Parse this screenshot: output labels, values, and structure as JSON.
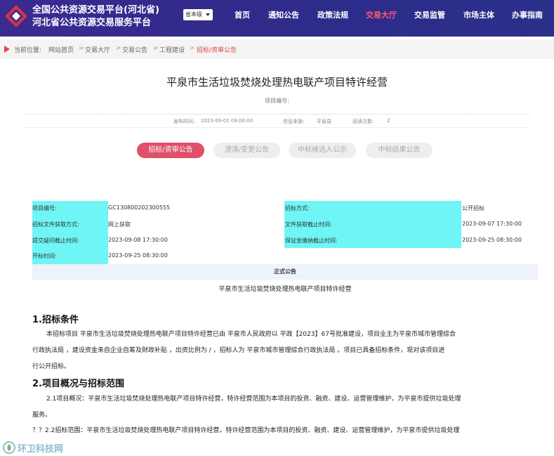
{
  "header": {
    "title_line1": "全国公共资源交易平台(河北省)",
    "title_line2": "河北省公共资源交易服务平台",
    "level_select": "省本级",
    "nav": [
      "首页",
      "通知公告",
      "政策法规",
      "交易大厅",
      "交易监管",
      "市场主体",
      "办事指南"
    ],
    "active_nav": "交易大厅"
  },
  "breadcrumb": {
    "label": "当前位置:",
    "items": [
      "网站首页",
      "交易大厅",
      "交易公告",
      "工程建设",
      "招标/资审公告"
    ],
    "separator": ">"
  },
  "article": {
    "title": "平泉市生活垃圾焚烧处理热电联产项目特许经营",
    "project_no_label": "项目编号:",
    "meta": {
      "publish_label": "发布时间:",
      "publish_time": "2023-09-01 09:00:00",
      "source_label": "信息来源:",
      "source": "平泉县",
      "views_label": "阅读次数:",
      "views": "2"
    }
  },
  "tabs": [
    {
      "label": "招标/资审公告",
      "active": true
    },
    {
      "label": "澄清/变更公告",
      "active": false
    },
    {
      "label": "中标候选人公示",
      "active": false
    },
    {
      "label": "中标结果公告",
      "active": false
    }
  ],
  "info": {
    "r1": {
      "l1": "项目编号:",
      "v1": "GC130800202300555",
      "l2": "招标方式:",
      "v2": "公开招标"
    },
    "r2": {
      "l1": "招标文件获取方式:",
      "v1": "网上获取",
      "l2": "文件获取截止时间:",
      "v2": "2023-09-07 17:30:00"
    },
    "r3": {
      "l1": "提交疑问截止时间:",
      "v1": "2023-09-08 17:30:00",
      "l2": "保证金缴纳截止时间:",
      "v2": "2023-09-25 08:30:00"
    },
    "r4": {
      "l1": "开标时间:",
      "v1": "2023-09-25 08:30:00"
    }
  },
  "notice": {
    "bar": "正式公告",
    "name": "平泉市生活垃圾焚烧处理热电联产项目特许经营"
  },
  "sections": {
    "s1_title": "1.招标条件",
    "s1_line1": "本招标项目  平泉市生活垃圾焚烧处理热电联产项目特许经营已由 平泉市人民政府以 平政【2023】67号批准建设，项目业主为平泉市城市管理综合",
    "s1_line2": "行政执法局 ，建设资金来自企业自筹及财政补贴 ，出资比例为  / ，招标人为  平泉市城市管理综合行政执法局 。项目已具备招标条件，现对该项目进",
    "s1_line3": "行公开招标。",
    "s2_title": "2.项目概况与招标范围",
    "s2_line1": "2.1项目概况：平泉市生活垃圾焚烧处理热电联产项目特许经营，特许经营范围为本项目的投资、融资、建设、运营管理维护，为平泉市提供垃圾处理",
    "s2_line2": "服务。",
    "s2_line3": "？？2.2招标范围：平泉市生活垃圾焚烧处理热电联产项目特许经营，特许经营范围为本项目的投资、融资、建设、运营管理维护，为平泉市提供垃圾处理"
  },
  "watermark": "环卫科技网",
  "colors": {
    "header_bg": "#3a2a92",
    "active_nav": "#ff5a6e",
    "accent": "#e0506a",
    "highlight": "#6ff5f5"
  }
}
